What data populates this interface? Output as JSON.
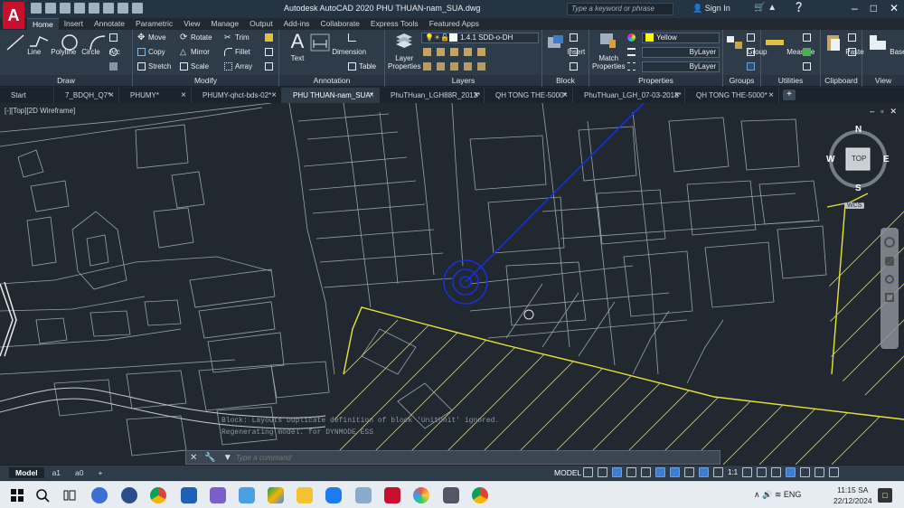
{
  "app": {
    "title": "Autodesk AutoCAD 2020   PHU THUAN-nam_SUA.dwg",
    "logo_letter": "A",
    "search_placeholder": "Type a keyword or phrase",
    "sign_in": "Sign In"
  },
  "ribbon_tabs": [
    "Home",
    "Insert",
    "Annotate",
    "Parametric",
    "View",
    "Manage",
    "Output",
    "Add-ins",
    "Collaborate",
    "Express Tools",
    "Featured Apps"
  ],
  "ribbon": {
    "draw": {
      "title": "Draw",
      "line": "Line",
      "polyline": "Polyline",
      "circle": "Circle",
      "arc": "Arc"
    },
    "modify": {
      "title": "Modify",
      "move": "Move",
      "rotate": "Rotate",
      "trim": "Trim",
      "copy": "Copy",
      "mirror": "Mirror",
      "fillet": "Fillet",
      "stretch": "Stretch",
      "scale": "Scale",
      "array": "Array"
    },
    "annotation": {
      "title": "Annotation",
      "text": "Text",
      "dimension": "Dimension",
      "table": "Table"
    },
    "layers": {
      "title": "Layers",
      "layer_properties_1": "Layer",
      "layer_properties_2": "Properties",
      "current_layer": "1.4.1 SDD-o-DH"
    },
    "block": {
      "title": "Block",
      "insert": "Insert"
    },
    "properties": {
      "title": "Properties",
      "match_1": "Match",
      "match_2": "Properties",
      "color": "Yellow",
      "linetype": "ByLayer",
      "lineweight": "ByLayer"
    },
    "groups": {
      "title": "Groups",
      "group": "Group"
    },
    "utilities": {
      "title": "Utilities",
      "measure": "Measure"
    },
    "clipboard": {
      "title": "Clipboard",
      "paste": "Paste"
    },
    "view": {
      "title": "View",
      "base": "Base"
    }
  },
  "doc_tabs": [
    "Start",
    "7_BDQH_Q7*",
    "PHUMY*",
    "PHUMY-qhct-bds-02*",
    "PHU THUAN-nam_SUA*",
    "PhuTHuan_LGH88R_2013*",
    "QH TONG THE-5000*",
    "PhuTHuan_LGH_07-03-2018*",
    "QH TONG THE-5000*"
  ],
  "viewport": {
    "label": "[-][Top][2D Wireframe]",
    "viewcube_top": "TOP",
    "compass": {
      "n": "N",
      "s": "S",
      "e": "E",
      "w": "W"
    },
    "wcs": "WCS",
    "history": [
      "Block: Layouts Duplicate definition of block 'UnitUnit' ignored.",
      "Regenerating model.      for DYNMODE ESS"
    ],
    "command_placeholder": "Type a command"
  },
  "status": {
    "layout_tabs": [
      "Model",
      "a1",
      "a0"
    ],
    "model": "MODEL",
    "scale": "1:1"
  },
  "taskbar": {
    "apps": [
      "start",
      "search",
      "task-view",
      "app-ht",
      "app-search",
      "chrome",
      "app-m",
      "app-window",
      "app-cloud",
      "app-drive",
      "file-explorer",
      "zalo",
      "app-tools",
      "autocad",
      "app-pinwheel",
      "app-wave",
      "chrome-2"
    ],
    "tray": "ENG",
    "time": "11:15 SA",
    "date": "22/12/2024"
  },
  "colors": {
    "canvas_bg": "#212830",
    "parcel_lines": "#9aa3ad",
    "boundary": "#e8e23a",
    "leader": "#1830d8",
    "road": "#e8e8e8"
  }
}
